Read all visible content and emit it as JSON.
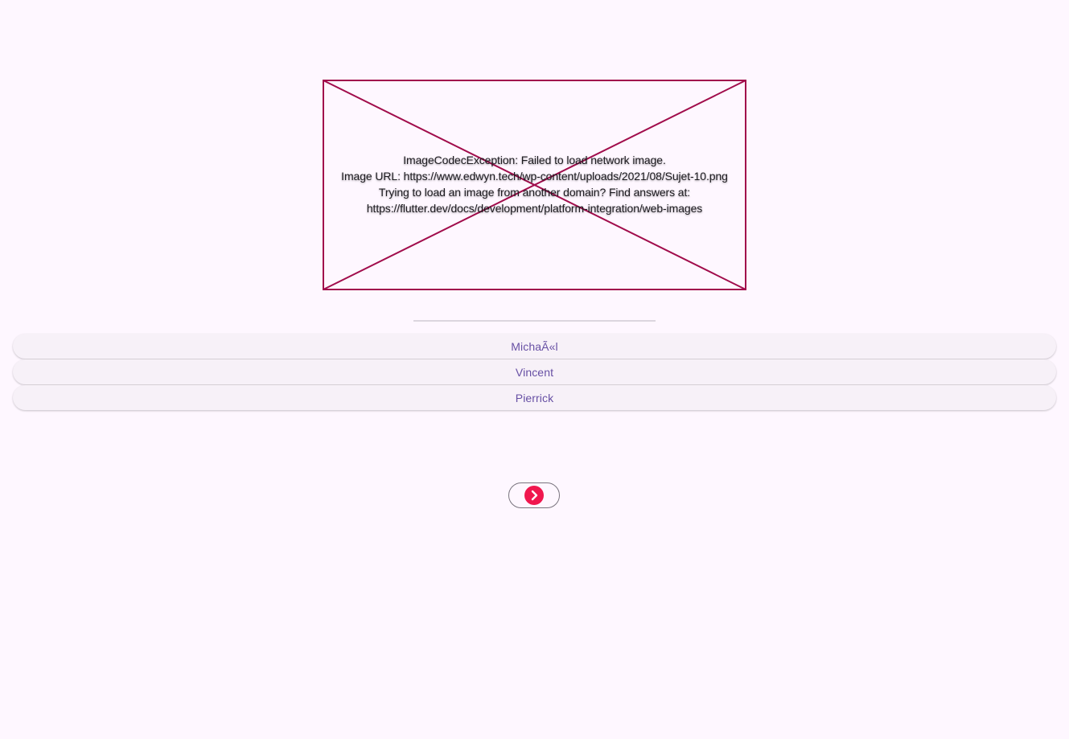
{
  "colors": {
    "background": "#fef7ff",
    "error_border": "#a10d4c",
    "option_text": "#6750a4",
    "option_background": "#f7f1f8",
    "next_icon": "#f0174e"
  },
  "image_error": {
    "icon": "broken-image-cross",
    "lines": [
      "ImageCodecException: Failed to load network image.",
      "Image URL: https://www.edwyn.tech/wp-content/uploads/2021/08/Sujet-10.png",
      "Trying to load an image from another domain? Find answers at:",
      "https://flutter.dev/docs/development/platform-integration/web-images"
    ]
  },
  "options": [
    {
      "label": "MichaÃ«l"
    },
    {
      "label": "Vincent"
    },
    {
      "label": "Pierrick"
    }
  ],
  "next_button": {
    "icon": "chevron-right-circle-icon"
  }
}
